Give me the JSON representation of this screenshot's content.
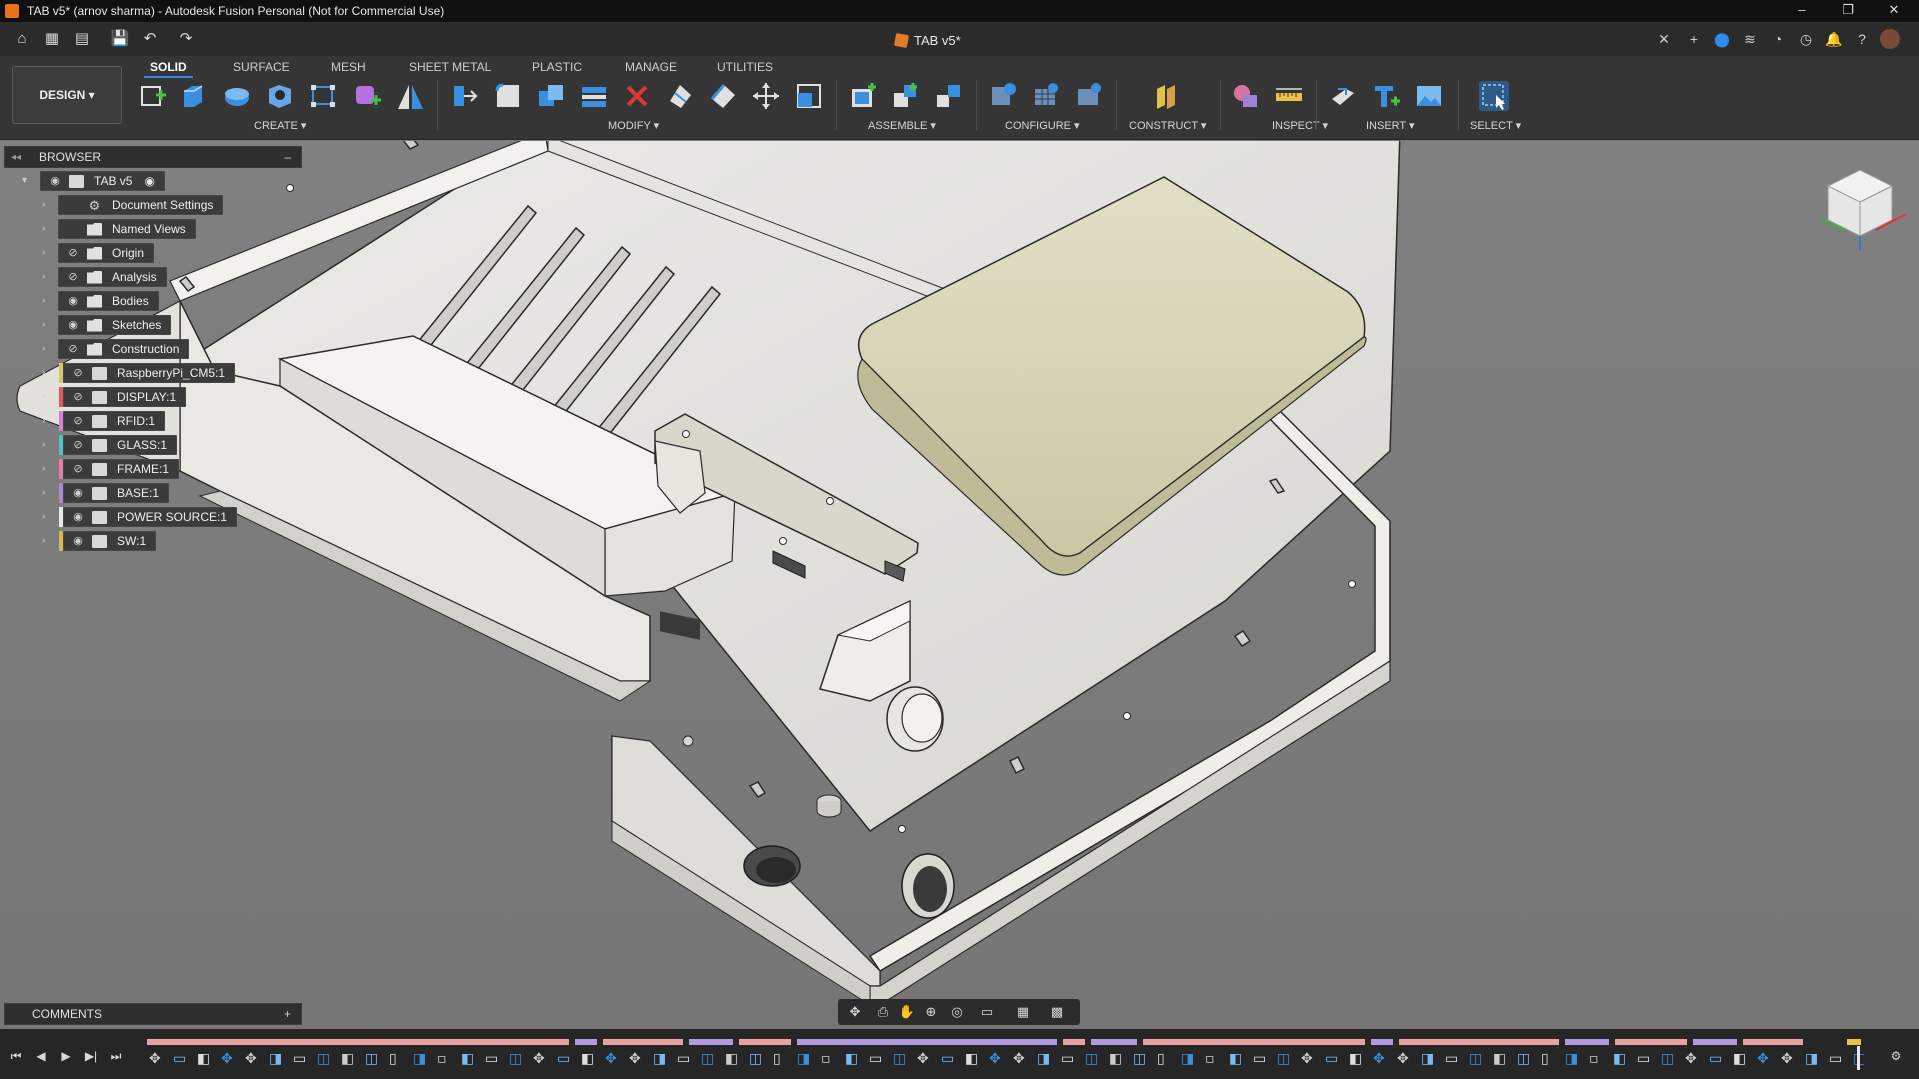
{
  "window": {
    "title": "TAB v5* (arnov sharma) - Autodesk Fusion Personal (Not for Commercial Use)",
    "controls": [
      "–",
      "❐",
      "✕"
    ]
  },
  "document_tab": {
    "label": "TAB v5*"
  },
  "design_button": {
    "label": "DESIGN ▾"
  },
  "ribbon_tabs": [
    "SOLID",
    "SURFACE",
    "MESH",
    "SHEET METAL",
    "PLASTIC",
    "MANAGE",
    "UTILITIES"
  ],
  "ribbon_groups": {
    "create": "CREATE ▾",
    "modify": "MODIFY ▾",
    "assemble": "ASSEMBLE ▾",
    "configure": "CONFIGURE ▾",
    "construct": "CONSTRUCT ▾",
    "inspect": "INSPECT ▾",
    "insert": "INSERT ▾",
    "select": "SELECT ▾"
  },
  "browser": {
    "title": "BROWSER",
    "root": "TAB v5",
    "items": [
      {
        "label": "Document Settings",
        "icon": "gear-icon",
        "visible": null
      },
      {
        "label": "Named Views",
        "icon": "folder-icon",
        "visible": null
      },
      {
        "label": "Origin",
        "icon": "folder-icon",
        "visible": false
      },
      {
        "label": "Analysis",
        "icon": "folder-icon",
        "visible": false
      },
      {
        "label": "Bodies",
        "icon": "folder-icon",
        "visible": true
      },
      {
        "label": "Sketches",
        "icon": "folder-icon",
        "visible": true
      },
      {
        "label": "Construction",
        "icon": "folder-icon",
        "visible": false
      },
      {
        "label": "RaspberryPi_CM5:1",
        "icon": "component-icon",
        "visible": false,
        "color": "#d8c56b"
      },
      {
        "label": "DISPLAY:1",
        "icon": "component-icon",
        "visible": false,
        "color": "#e05a5a"
      },
      {
        "label": "RFID:1",
        "icon": "component-icon",
        "visible": false,
        "color": "#d87fd6"
      },
      {
        "label": "GLASS:1",
        "icon": "component-icon",
        "visible": false,
        "color": "#4fc4c4"
      },
      {
        "label": "FRAME:1",
        "icon": "component-icon",
        "visible": false,
        "color": "#e07fb0"
      },
      {
        "label": "BASE:1",
        "icon": "component-icon",
        "visible": true,
        "color": "#a58ad6"
      },
      {
        "label": "POWER SOURCE:1",
        "icon": "component-icon",
        "visible": true,
        "color": "#e8e8e8"
      },
      {
        "label": "SW:1",
        "icon": "component-icon",
        "visible": true,
        "color": "#d8b94f"
      }
    ]
  },
  "comments": {
    "title": "COMMENTS"
  },
  "colors": {
    "accent": "#2d8cf0",
    "ribbon_bg": "#353535",
    "viewport_bg": "#7c7c7c",
    "model": "#e9e8e3",
    "battery": "#d7d4b8"
  }
}
